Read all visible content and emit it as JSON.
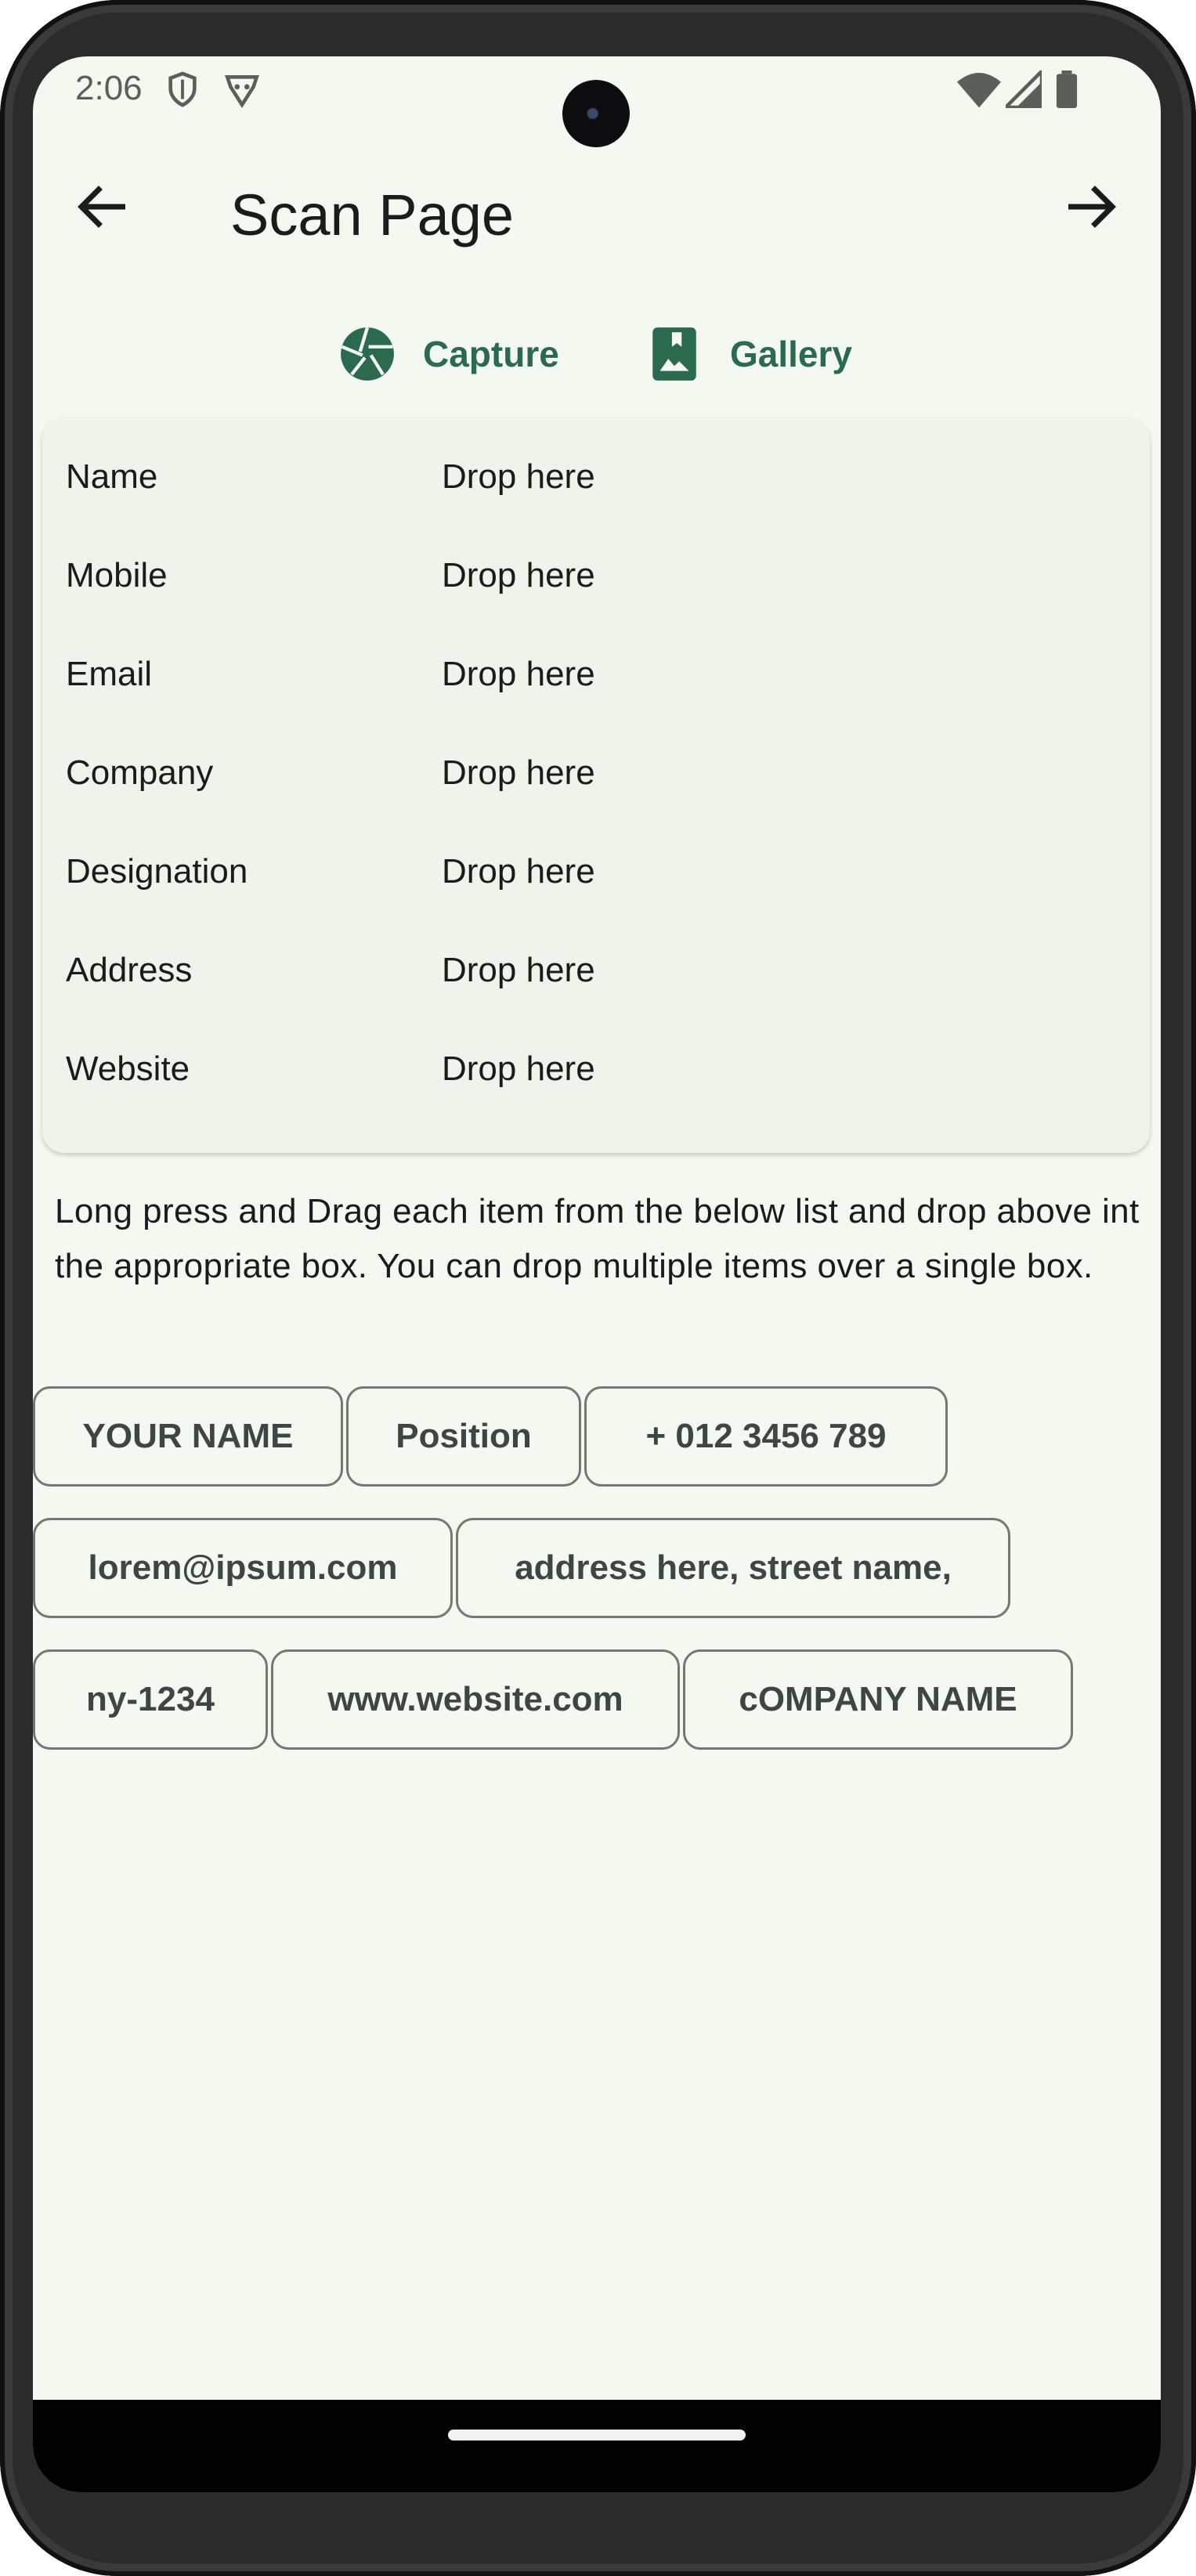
{
  "status": {
    "time": "2:06",
    "icons": [
      "shield-icon",
      "notification-icon",
      "wifi-icon",
      "signal-icon",
      "battery-icon"
    ]
  },
  "appbar": {
    "title": "Scan Page",
    "back_icon": "arrow-left-icon",
    "forward_icon": "arrow-right-icon"
  },
  "actions": {
    "capture_label": "Capture",
    "gallery_label": "Gallery",
    "accent": "#2b6a4c"
  },
  "fields": [
    {
      "label": "Name",
      "value": "Drop here"
    },
    {
      "label": "Mobile",
      "value": "Drop here"
    },
    {
      "label": "Email",
      "value": "Drop here"
    },
    {
      "label": "Company",
      "value": "Drop here"
    },
    {
      "label": "Designation",
      "value": "Drop here"
    },
    {
      "label": "Address",
      "value": "Drop here"
    },
    {
      "label": "Website",
      "value": "Drop here"
    }
  ],
  "instructions": "Long press and Drag each item from the below list and drop above int the appropriate box. You can drop multiple items over a single box.",
  "chips": [
    "YOUR NAME",
    "Position",
    "+ 012 3456 789",
    "lorem@ipsum.com",
    "address here, street name,",
    "ny-1234",
    "www.website.com",
    "cOMPANY NAME"
  ],
  "colors": {
    "background": "#f3f8f1",
    "card": "#eef3ec",
    "chip_border": "#747875"
  }
}
